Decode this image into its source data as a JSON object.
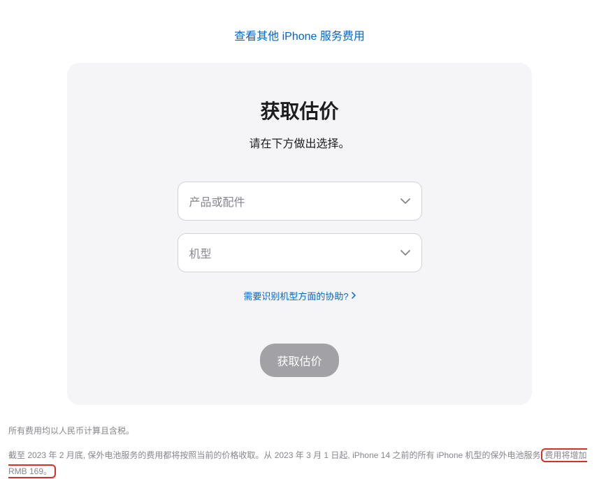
{
  "topLink": {
    "label": "查看其他 iPhone 服务费用"
  },
  "card": {
    "title": "获取估价",
    "subtitle": "请在下方做出选择。",
    "select1": {
      "placeholder": "产品或配件"
    },
    "select2": {
      "placeholder": "机型"
    },
    "helpLink": {
      "label": "需要识别机型方面的协助?"
    },
    "submitButton": {
      "label": "获取估价"
    }
  },
  "footer": {
    "line1": "所有费用均以人民币计算且含税。",
    "line2_part1": "截至 2023 年 2 月底, 保外电池服务的费用都将按照当前的价格收取。从 2023 年 3 月 1 日起, iPhone 14 之前的所有 iPhone 机型的保外电池服务",
    "line2_highlight": "费用将增加 RMB 169。"
  }
}
